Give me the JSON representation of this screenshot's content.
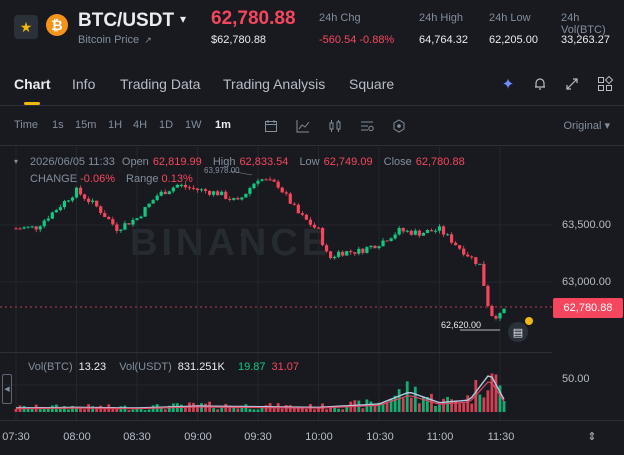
{
  "header": {
    "pair": "BTC/USDT",
    "subtitle": "Bitcoin Price",
    "subtitle_link": "↗",
    "last_price": "62,780.88",
    "last_price_usd": "$62,780.88",
    "stats": [
      {
        "label": "24h Chg",
        "value": "-560.54 -0.88%"
      },
      {
        "label": "24h High",
        "value": "64,764.32"
      },
      {
        "label": "24h Low",
        "value": "62,205.00"
      },
      {
        "label": "24h Vol(BTC)",
        "value": "33,263.27"
      }
    ]
  },
  "tabs": [
    "Chart",
    "Info",
    "Trading Data",
    "Trading Analysis",
    "Square"
  ],
  "active_tab": "Chart",
  "toolbar": {
    "time_label": "Time",
    "intervals": [
      "1s",
      "15m",
      "1H",
      "4H",
      "1D",
      "1W",
      "1m"
    ],
    "active_interval": "1m",
    "view_select": "Original"
  },
  "ohlc": {
    "date": "2026/06/05 11:33",
    "open_label": "Open",
    "open": "62,819.99",
    "high_label": "High",
    "high": "62,833.54",
    "low_label": "Low",
    "low": "62,749.09",
    "close_label": "Close",
    "close": "62,780.88",
    "change_label": "CHANGE",
    "change": "-0.06%",
    "range_label": "Range",
    "range": "0.13%"
  },
  "price_axis": {
    "labels": [
      "63,500.00",
      "63,000.00"
    ],
    "current": "62,780.88",
    "high_marker": "63,978.00",
    "low_marker": "62,620.00"
  },
  "watermark": "BINANCE",
  "volume": {
    "label_btc": "Vol(BTC)",
    "btc": "13.23",
    "label_usdt": "Vol(USDT)",
    "usdt": "831.251K",
    "ma1": "19.87",
    "ma2": "31.07",
    "axis_label": "50.00"
  },
  "time_axis": [
    "07:30",
    "08:00",
    "08:30",
    "09:00",
    "09:30",
    "10:00",
    "10:30",
    "11:00",
    "11:30"
  ],
  "icons": {
    "favorite": "star-icon",
    "coin": "bitcoin-icon",
    "ai": "sparkle-icon",
    "alert": "bell-icon",
    "expand": "expand-icon",
    "layout": "layout-icon"
  },
  "colors": {
    "up": "#0ecb81",
    "down": "#f6465d",
    "accent": "#f0b90b",
    "background": "#181a20"
  },
  "chart_data": {
    "type": "candlestick",
    "interval": "1m",
    "x_range": [
      "07:30",
      "11:33"
    ],
    "ylim": [
      62600,
      64000
    ],
    "y_ticks": [
      63000,
      63500
    ],
    "close_path": [
      {
        "t": "07:30",
        "price": 63470
      },
      {
        "t": "07:40",
        "price": 63480
      },
      {
        "t": "07:50",
        "price": 63640
      },
      {
        "t": "08:00",
        "price": 63800
      },
      {
        "t": "08:10",
        "price": 63660
      },
      {
        "t": "08:20",
        "price": 63470
      },
      {
        "t": "08:30",
        "price": 63560
      },
      {
        "t": "08:40",
        "price": 63760
      },
      {
        "t": "08:50",
        "price": 63850
      },
      {
        "t": "09:00",
        "price": 63810
      },
      {
        "t": "09:10",
        "price": 63780
      },
      {
        "t": "09:20",
        "price": 63700
      },
      {
        "t": "09:30",
        "price": 63910
      },
      {
        "t": "09:40",
        "price": 63850
      },
      {
        "t": "09:50",
        "price": 63600
      },
      {
        "t": "10:00",
        "price": 63450
      },
      {
        "t": "10:05",
        "price": 63200
      },
      {
        "t": "10:10",
        "price": 63260
      },
      {
        "t": "10:20",
        "price": 63270
      },
      {
        "t": "10:30",
        "price": 63340
      },
      {
        "t": "10:40",
        "price": 63450
      },
      {
        "t": "10:50",
        "price": 63430
      },
      {
        "t": "11:00",
        "price": 63460
      },
      {
        "t": "11:10",
        "price": 63300
      },
      {
        "t": "11:20",
        "price": 63150
      },
      {
        "t": "11:25",
        "price": 62720
      },
      {
        "t": "11:30",
        "price": 62700
      },
      {
        "t": "11:33",
        "price": 62780.88
      }
    ],
    "high_marker": {
      "t": "09:25",
      "price": 63978.0
    },
    "low_marker": {
      "t": "11:30",
      "price": 62620.0
    },
    "volume_btc": [
      {
        "t": "07:30",
        "v": 6
      },
      {
        "t": "08:00",
        "v": 7
      },
      {
        "t": "08:30",
        "v": 6
      },
      {
        "t": "09:00",
        "v": 9
      },
      {
        "t": "09:30",
        "v": 8
      },
      {
        "t": "10:00",
        "v": 7
      },
      {
        "t": "10:30",
        "v": 12
      },
      {
        "t": "10:45",
        "v": 30
      },
      {
        "t": "11:00",
        "v": 14
      },
      {
        "t": "11:15",
        "v": 18
      },
      {
        "t": "11:25",
        "v": 58
      },
      {
        "t": "11:33",
        "v": 13.23
      }
    ]
  }
}
